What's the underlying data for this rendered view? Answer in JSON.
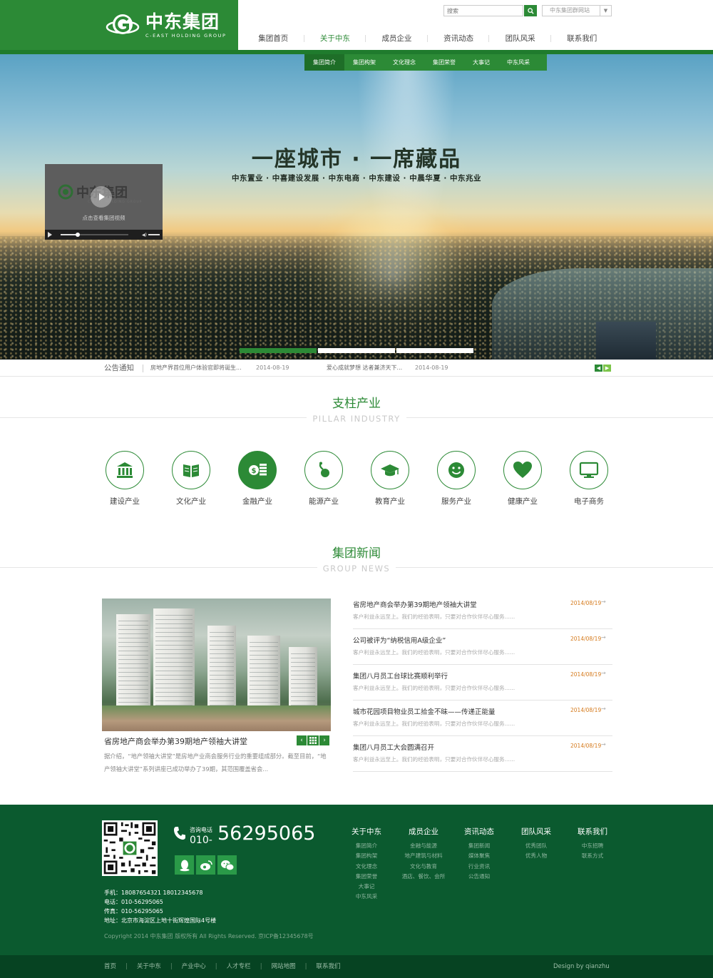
{
  "brand": {
    "name_cn": "中东集团",
    "name_en": "C-EAST HOLDING GROUP",
    "color": "#2c8a36"
  },
  "search": {
    "placeholder": "搜索"
  },
  "group_select": {
    "value": "中东集团群网站"
  },
  "nav": {
    "items": [
      {
        "label": "集团首页"
      },
      {
        "label": "关于中东"
      },
      {
        "label": "成员企业"
      },
      {
        "label": "资讯动态"
      },
      {
        "label": "团队风采"
      },
      {
        "label": "联系我们"
      }
    ],
    "active": "关于中东"
  },
  "subnav": {
    "items": [
      {
        "label": "集团简介"
      },
      {
        "label": "集团构架"
      },
      {
        "label": "文化理念"
      },
      {
        "label": "集团荣誉"
      },
      {
        "label": "大事记"
      },
      {
        "label": "中东风采"
      }
    ],
    "active": "集团简介"
  },
  "hero": {
    "slogan": "一座城市 · 一席藏品",
    "subslogan": "中东置业 · 中喜建设发展 · 中东电商 · 中东建设 · 中晨华夏 · 中东兆业",
    "video": {
      "logo_text": "中东集团",
      "logo_en": "C-EAST HOLDING GROUP",
      "caption": "点击查看集团视频",
      "progress": 0.25
    },
    "slides": {
      "count": 3,
      "active": 1
    }
  },
  "notice": {
    "label": "公告通知",
    "items": [
      {
        "title": "房地产界首位用户体验官即将诞生...",
        "date": "2014-08-19"
      },
      {
        "title": "爱心成就梦想 达者兼济天下...",
        "date": "2014-08-19"
      }
    ]
  },
  "pillar": {
    "title_cn": "支柱产业",
    "title_en": "PILLAR INDUSTRY",
    "items": [
      {
        "label": "建设产业",
        "icon": "bank-icon"
      },
      {
        "label": "文化产业",
        "icon": "book-icon"
      },
      {
        "label": "金融产业",
        "icon": "coins-icon"
      },
      {
        "label": "能源产业",
        "icon": "energy-icon"
      },
      {
        "label": "教育产业",
        "icon": "graduation-cap-icon"
      },
      {
        "label": "服务产业",
        "icon": "smile-icon"
      },
      {
        "label": "健康产业",
        "icon": "heart-icon"
      },
      {
        "label": "电子商务",
        "icon": "monitor-icon"
      }
    ],
    "active": "金融产业"
  },
  "news": {
    "title_cn": "集团新闻",
    "title_en": "GROUP NEWS",
    "feature": {
      "title": "省房地产商会举办第39期地产领袖大讲堂",
      "summary": "据介绍，“地产领袖大讲堂”是房地产业商会服务行业的重要组成部分。截至目前，“地产领袖大讲堂”系列讲座已成功举办了39期，其范围覆盖省会..."
    },
    "items": [
      {
        "title": "省房地产商会举办第39期地产领袖大讲堂",
        "date": "2014/08/19",
        "summary": "客户利益永远至上。我们的经验表明，只要对合作伙伴尽心服务......"
      },
      {
        "title": "公司被评为“纳税信用A级企业”",
        "date": "2014/08/19",
        "summary": "客户利益永远至上。我们的经验表明，只要对合作伙伴尽心服务......"
      },
      {
        "title": "集团八月员工台球比赛顺利举行",
        "date": "2014/08/19",
        "summary": "客户利益永远至上。我们的经验表明，只要对合作伙伴尽心服务......"
      },
      {
        "title": "城市花园项目物业员工拾金不昧——传递正能量",
        "date": "2014/08/19",
        "summary": "客户利益永远至上。我们的经验表明，只要对合作伙伴尽心服务......"
      },
      {
        "title": "集团八月员工大会圆满召开",
        "date": "2014/08/19",
        "summary": "客户利益永远至上。我们的经验表明，只要对合作伙伴尽心服务......"
      }
    ]
  },
  "footer": {
    "hotline_label": "咨询电话",
    "hotline_prefix": "010-",
    "hotline_number": "56295065",
    "socials": [
      "qq-icon",
      "weibo-icon",
      "wechat-icon"
    ],
    "contacts": [
      "手机：18087654321  18012345678",
      "电话：010-56295065",
      "传真：010-56295065",
      "地址：北京市海淀区上地十街辉煌国际4号楼"
    ],
    "copyright": "Copyright 2014 中东集团 版权所有 All Rights Reserved.   京ICP备12345678号",
    "columns": [
      {
        "title": "关于中东",
        "links": [
          "集团简介",
          "集团构架",
          "文化理念",
          "集团荣誉",
          "大事记",
          "中东风采"
        ]
      },
      {
        "title": "成员企业",
        "links": [
          "金融与能源",
          "地产建筑与材料",
          "文化与教育",
          "酒店、餐饮、会所"
        ]
      },
      {
        "title": "资讯动态",
        "links": [
          "集团新闻",
          "媒体聚焦",
          "行业资讯",
          "公告通知"
        ]
      },
      {
        "title": "团队风采",
        "links": [
          "优秀团队",
          "优秀人物"
        ]
      },
      {
        "title": "联系我们",
        "links": [
          "中东招聘",
          "联系方式"
        ]
      }
    ],
    "bottom_links": [
      "首页",
      "关于中东",
      "产业中心",
      "人才专栏",
      "网站地图",
      "联系我们"
    ],
    "design_credit": "Design by qianzhu"
  }
}
